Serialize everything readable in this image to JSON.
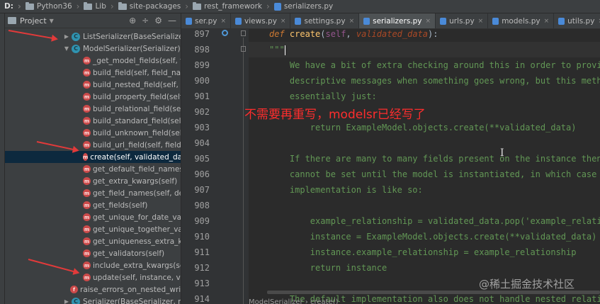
{
  "breadcrumbs": [
    "D:",
    "Python36",
    "Lib",
    "site-packages",
    "rest_framework",
    "serializers.py"
  ],
  "project_panel": {
    "title": "Project",
    "tools": [
      "⊕",
      "÷",
      "⚙",
      "—"
    ],
    "items": [
      {
        "kind": "class",
        "label": "ListSerializer(BaseSerializer)",
        "expand": "▶"
      },
      {
        "kind": "class",
        "label": "ModelSerializer(Serializer)",
        "expand": "▼"
      },
      {
        "kind": "method",
        "label": "_get_model_fields(self, field"
      },
      {
        "kind": "method",
        "label": "build_field(self, field_name"
      },
      {
        "kind": "method",
        "label": "build_nested_field(self, fiel"
      },
      {
        "kind": "method",
        "label": "build_property_field(self, fi"
      },
      {
        "kind": "method",
        "label": "build_relational_field(self, fi"
      },
      {
        "kind": "method",
        "label": "build_standard_field(self, fi"
      },
      {
        "kind": "method",
        "label": "build_unknown_field(self, fi"
      },
      {
        "kind": "method",
        "label": "build_url_field(self, field_na"
      },
      {
        "kind": "method",
        "label": "create(self, validated_data",
        "selected": true
      },
      {
        "kind": "method",
        "label": "get_default_field_names(sel"
      },
      {
        "kind": "method",
        "label": "get_extra_kwargs(self)"
      },
      {
        "kind": "method",
        "label": "get_field_names(self, decla"
      },
      {
        "kind": "method",
        "label": "get_fields(self)"
      },
      {
        "kind": "method",
        "label": "get_unique_for_date_valida"
      },
      {
        "kind": "method",
        "label": "get_unique_together_valid"
      },
      {
        "kind": "method",
        "label": "get_uniqueness_extra_kwa"
      },
      {
        "kind": "method",
        "label": "get_validators(self)"
      },
      {
        "kind": "method",
        "label": "include_extra_kwargs(self,"
      },
      {
        "kind": "method",
        "label": "update(self, instance, valid"
      },
      {
        "kind": "method",
        "label": "raise_errors_on_nested_writes",
        "top": true
      },
      {
        "kind": "class",
        "label": "Serializer(BaseSerializer, meta",
        "expand": "▶",
        "top": true
      }
    ]
  },
  "tabs": [
    {
      "label": "ser.py"
    },
    {
      "label": "views.py"
    },
    {
      "label": "settings.py"
    },
    {
      "label": "serializers.py",
      "active": true
    },
    {
      "label": "urls.py"
    },
    {
      "label": "models.py"
    },
    {
      "label": "utils.py"
    }
  ],
  "tab_close": "×",
  "line_numbers": [
    "897",
    "898",
    "899",
    "900",
    "901",
    "902",
    "903",
    "904",
    "905",
    "906",
    "907",
    "908",
    "909",
    "910",
    "911",
    "912",
    "913",
    "914"
  ],
  "code": {
    "def_kw": "def",
    "def_name": "create",
    "def_self": "self",
    "def_param": "validated_data",
    "doc_open": "\"\"\"",
    "lines": [
      "    We have a bit of extra checking around this in order to provi",
      "    descriptive messages when something goes wrong, but this meth",
      "    essentially just:",
      "",
      "        return ExampleModel.objects.create(**validated_data)",
      "",
      "    If there are many to many fields present on the instance then",
      "    cannot be set until the model is instantiated, in which case",
      "    implementation is like so:",
      "",
      "        example_relationship = validated_data.pop('example_relati",
      "        instance = ExampleModel.objects.create(**validated_data)",
      "        instance.example_relationship = example_relationship",
      "        return instance",
      "",
      "    The default implementation also does not handle nested relati"
    ],
    "status": "ModelSerializer › create()"
  },
  "annotation": "不需要再重写，modelsr已经写了",
  "watermark": "@稀土掘金技术社区",
  "colors": {
    "annotation_red": "#ff2d2d",
    "selection": "#0d293e",
    "docstring": "#629755"
  }
}
